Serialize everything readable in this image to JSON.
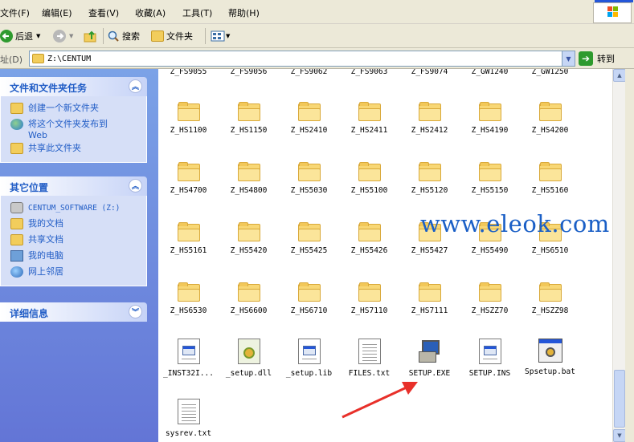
{
  "menu": [
    "文件(F)",
    "编辑(E)",
    "查看(V)",
    "收藏(A)",
    "工具(T)",
    "帮助(H)"
  ],
  "toolbar": {
    "back": "后退",
    "search": "搜索",
    "folders": "文件夹"
  },
  "address": {
    "label": "址(D)",
    "path": "Z:\\CENTUM",
    "go": "转到"
  },
  "left_panel": {
    "tasks": {
      "title": "文件和文件夹任务",
      "items": [
        "创建一个新文件夹",
        "将这个文件夹发布到",
        "Web",
        "共享此文件夹"
      ]
    },
    "places": {
      "title": "其它位置",
      "items": [
        "CENTUM_SOFTWARE (Z:)",
        "我的文档",
        "共享文档",
        "我的电脑",
        "网上邻居"
      ]
    },
    "details": {
      "title": "详细信息"
    }
  },
  "files": {
    "row0": [
      "Z_FS9055",
      "Z_FS9056",
      "Z_FS9062",
      "Z_FS9063",
      "Z_FS9074",
      "Z_GW1240",
      "Z_GW1250"
    ],
    "row1": [
      "Z_HS1100",
      "Z_HS1150",
      "Z_HS2410",
      "Z_HS2411",
      "Z_HS2412",
      "Z_HS4190",
      "Z_HS4200"
    ],
    "row2": [
      "Z_HS4700",
      "Z_HS4800",
      "Z_HS5030",
      "Z_HS5100",
      "Z_HS5120",
      "Z_HS5150",
      "Z_HS5160"
    ],
    "row3": [
      "Z_HS5161",
      "Z_HS5420",
      "Z_HS5425",
      "Z_HS5426",
      "Z_HS5427",
      "Z_HS5490",
      "Z_HS6510"
    ],
    "row4": [
      "Z_HS6530",
      "Z_HS6600",
      "Z_HS6710",
      "Z_HS7110",
      "Z_HS7111",
      "Z_HSZZ70",
      "Z_HSZZ98"
    ],
    "row5": [
      "_INST32I...",
      "_setup.dll",
      "_setup.lib",
      "FILES.txt",
      "SETUP.EXE",
      "SETUP.INS",
      "Spsetup.bat"
    ],
    "row6": [
      "sysrev.txt"
    ]
  },
  "watermark": "www.eleok.com"
}
